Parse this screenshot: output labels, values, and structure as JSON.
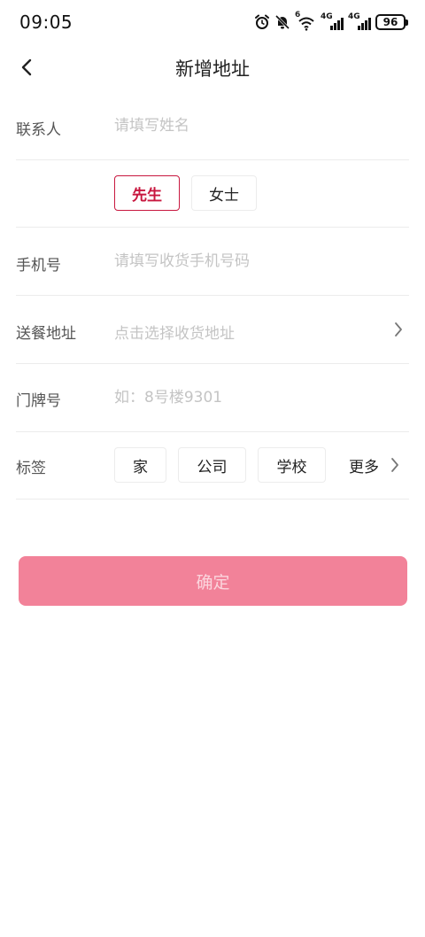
{
  "status_bar": {
    "time": "09:05",
    "network_1": "4G",
    "network_2": "4G",
    "wifi_tag": "6",
    "battery": "96"
  },
  "nav": {
    "title": "新增地址"
  },
  "form": {
    "contact": {
      "label": "联系人",
      "placeholder": "请填写姓名"
    },
    "gender": {
      "options": [
        "先生",
        "女士"
      ],
      "selected": "先生"
    },
    "phone": {
      "label": "手机号",
      "placeholder": "请填写收货手机号码"
    },
    "address": {
      "label": "送餐地址",
      "placeholder": "点击选择收货地址"
    },
    "house": {
      "label": "门牌号",
      "placeholder": "如：8号楼9301"
    },
    "tags": {
      "label": "标签",
      "options": [
        "家",
        "公司",
        "学校"
      ],
      "more": "更多"
    }
  },
  "confirm_button": {
    "label": "确定"
  },
  "colors": {
    "accent": "#c8173f",
    "button": "#f28299",
    "button_text": "#fbd5dd"
  }
}
